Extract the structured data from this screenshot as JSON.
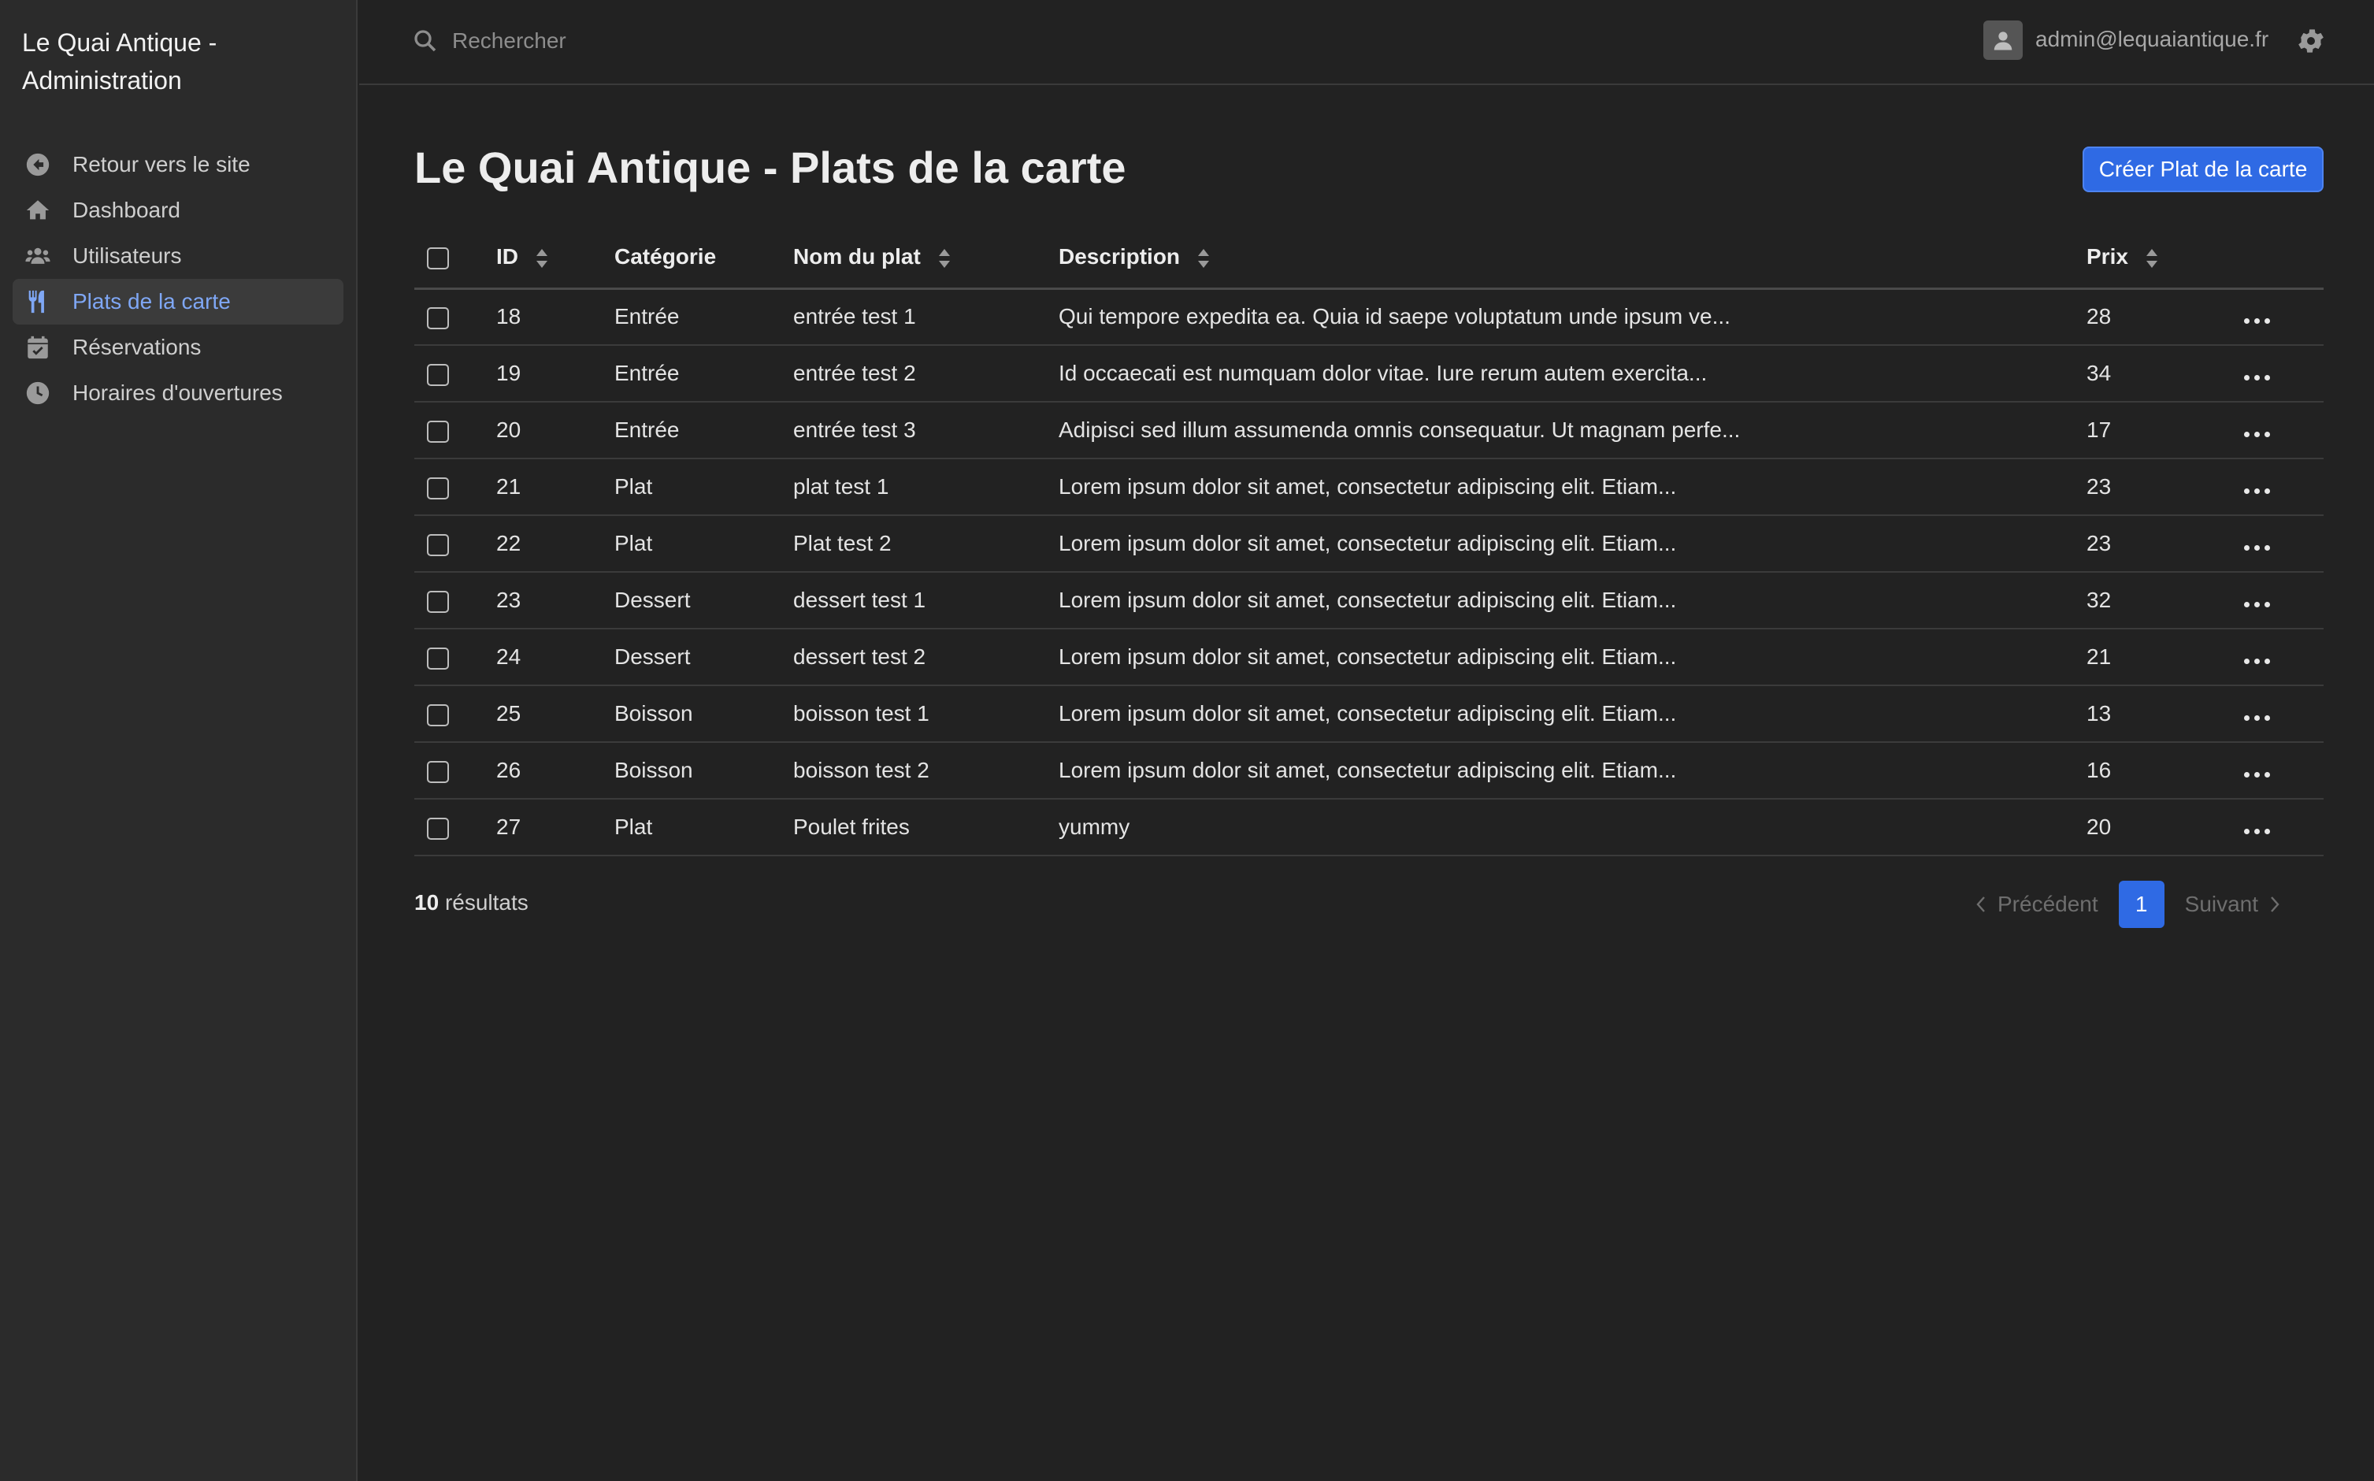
{
  "sidebar": {
    "brand": "Le Quai Antique - Administration",
    "items": [
      {
        "label": "Retour vers le site",
        "icon": "arrow-circle-left-icon",
        "active": false
      },
      {
        "label": "Dashboard",
        "icon": "home-icon",
        "active": false
      },
      {
        "label": "Utilisateurs",
        "icon": "users-icon",
        "active": false
      },
      {
        "label": "Plats de la carte",
        "icon": "utensils-icon",
        "active": true
      },
      {
        "label": "Réservations",
        "icon": "calendar-check-icon",
        "active": false
      },
      {
        "label": "Horaires d'ouvertures",
        "icon": "clock-icon",
        "active": false
      }
    ]
  },
  "topbar": {
    "search_placeholder": "Rechercher",
    "user_email": "admin@lequaiantique.fr"
  },
  "main": {
    "title": "Le Quai Antique - Plats de la carte",
    "create_button": "Créer Plat de la carte",
    "columns": {
      "id": "ID",
      "category": "Catégorie",
      "name": "Nom du plat",
      "description": "Description",
      "price": "Prix"
    },
    "rows": [
      {
        "id": "18",
        "category": "Entrée",
        "name": "entrée test 1",
        "description": "Qui tempore expedita ea. Quia id saepe voluptatum unde ipsum ve...",
        "price": "28"
      },
      {
        "id": "19",
        "category": "Entrée",
        "name": "entrée test 2",
        "description": "Id occaecati est numquam dolor vitae. Iure rerum autem exercita...",
        "price": "34"
      },
      {
        "id": "20",
        "category": "Entrée",
        "name": "entrée test 3",
        "description": "Adipisci sed illum assumenda omnis consequatur. Ut magnam perfe...",
        "price": "17"
      },
      {
        "id": "21",
        "category": "Plat",
        "name": "plat test 1",
        "description": "Lorem ipsum dolor sit amet, consectetur adipiscing elit. Etiam...",
        "price": "23"
      },
      {
        "id": "22",
        "category": "Plat",
        "name": "Plat test 2",
        "description": "Lorem ipsum dolor sit amet, consectetur adipiscing elit. Etiam...",
        "price": "23"
      },
      {
        "id": "23",
        "category": "Dessert",
        "name": "dessert test 1",
        "description": "Lorem ipsum dolor sit amet, consectetur adipiscing elit. Etiam...",
        "price": "32"
      },
      {
        "id": "24",
        "category": "Dessert",
        "name": "dessert test 2",
        "description": "Lorem ipsum dolor sit amet, consectetur adipiscing elit. Etiam...",
        "price": "21"
      },
      {
        "id": "25",
        "category": "Boisson",
        "name": "boisson test 1",
        "description": "Lorem ipsum dolor sit amet, consectetur adipiscing elit. Etiam...",
        "price": "13"
      },
      {
        "id": "26",
        "category": "Boisson",
        "name": "boisson test 2",
        "description": "Lorem ipsum dolor sit amet, consectetur adipiscing elit. Etiam...",
        "price": "16"
      },
      {
        "id": "27",
        "category": "Plat",
        "name": "Poulet frites",
        "description": "yummy",
        "price": "20"
      }
    ],
    "result_count": "10",
    "result_label": "résultats",
    "pagination": {
      "prev": "Précédent",
      "current": "1",
      "next": "Suivant"
    }
  },
  "colors": {
    "accent": "#2f6ae4",
    "active_nav_text": "#7fa7f5",
    "background": "#222222",
    "sidebar": "#2b2b2b"
  }
}
